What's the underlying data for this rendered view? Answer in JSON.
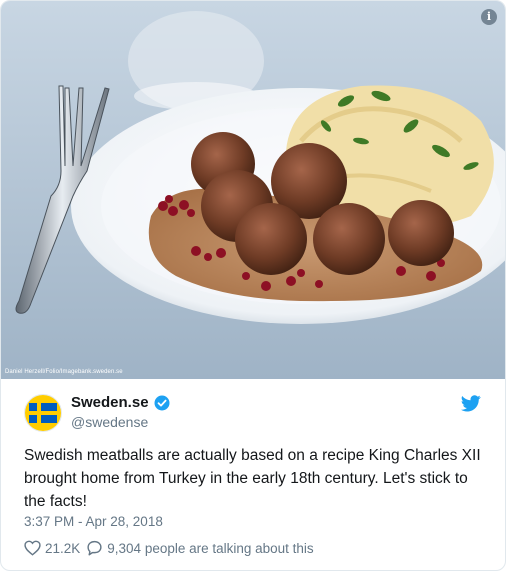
{
  "media": {
    "credit": "Daniel Herzell/Folio/Imagebank.sweden.se",
    "info_icon": "i"
  },
  "tweet": {
    "display_name": "Sweden.se",
    "handle": "@swedense",
    "text": "Swedish meatballs are actually based on a recipe King Charles XII brought home from Turkey in the early 18th century. Let's stick to the facts!",
    "timestamp": "3:37 PM - Apr 28, 2018",
    "likes": "21.2K",
    "replies_text": "9,304 people are talking about this"
  },
  "colors": {
    "twitter_blue": "#1da1f2",
    "flag_blue": "#005cbf",
    "flag_yellow": "#ffcd00",
    "muted": "#657786",
    "text": "#14171a"
  },
  "icons": {
    "verified": "verified-badge-icon",
    "brand": "twitter-bird-icon",
    "like": "heart-icon",
    "reply": "speech-bubble-icon",
    "info": "info-icon"
  }
}
